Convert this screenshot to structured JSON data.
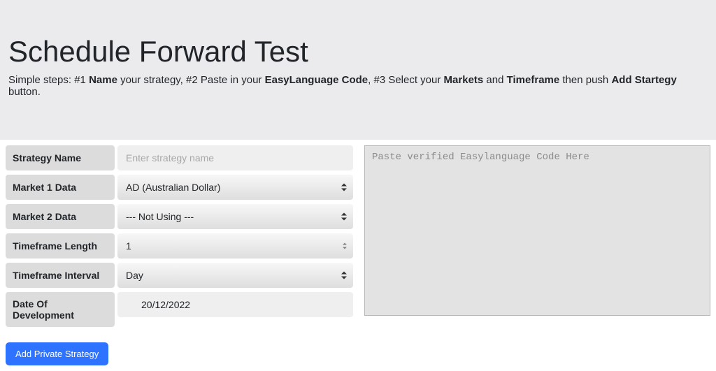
{
  "header": {
    "title": "Schedule Forward Test",
    "intro_prefix": "Simple steps: #1 ",
    "b1": "Name",
    "t1": " your strategy, #2 Paste in your ",
    "b2": "EasyLanguage Code",
    "t2": ", #3 Select your ",
    "b3": "Markets",
    "t3": " and ",
    "b4": "Timeframe",
    "t4": " then push ",
    "b5": "Add Startegy",
    "t5": " button."
  },
  "labels": {
    "strategy_name": "Strategy Name",
    "market1": "Market 1 Data",
    "market2": "Market 2 Data",
    "timeframe_length": "Timeframe Length",
    "timeframe_interval": "Timeframe Interval",
    "date_of_development": "Date Of Development"
  },
  "fields": {
    "strategy_name_placeholder": "Enter strategy name",
    "market1_value": "AD (Australian Dollar)",
    "market2_value": "--- Not Using ---",
    "timeframe_length_value": "1",
    "timeframe_interval_value": "Day",
    "date_of_development_value": "20/12/2022",
    "code_placeholder": "Paste verified Easylanguage Code Here"
  },
  "buttons": {
    "add_private_strategy": "Add Private Strategy"
  }
}
